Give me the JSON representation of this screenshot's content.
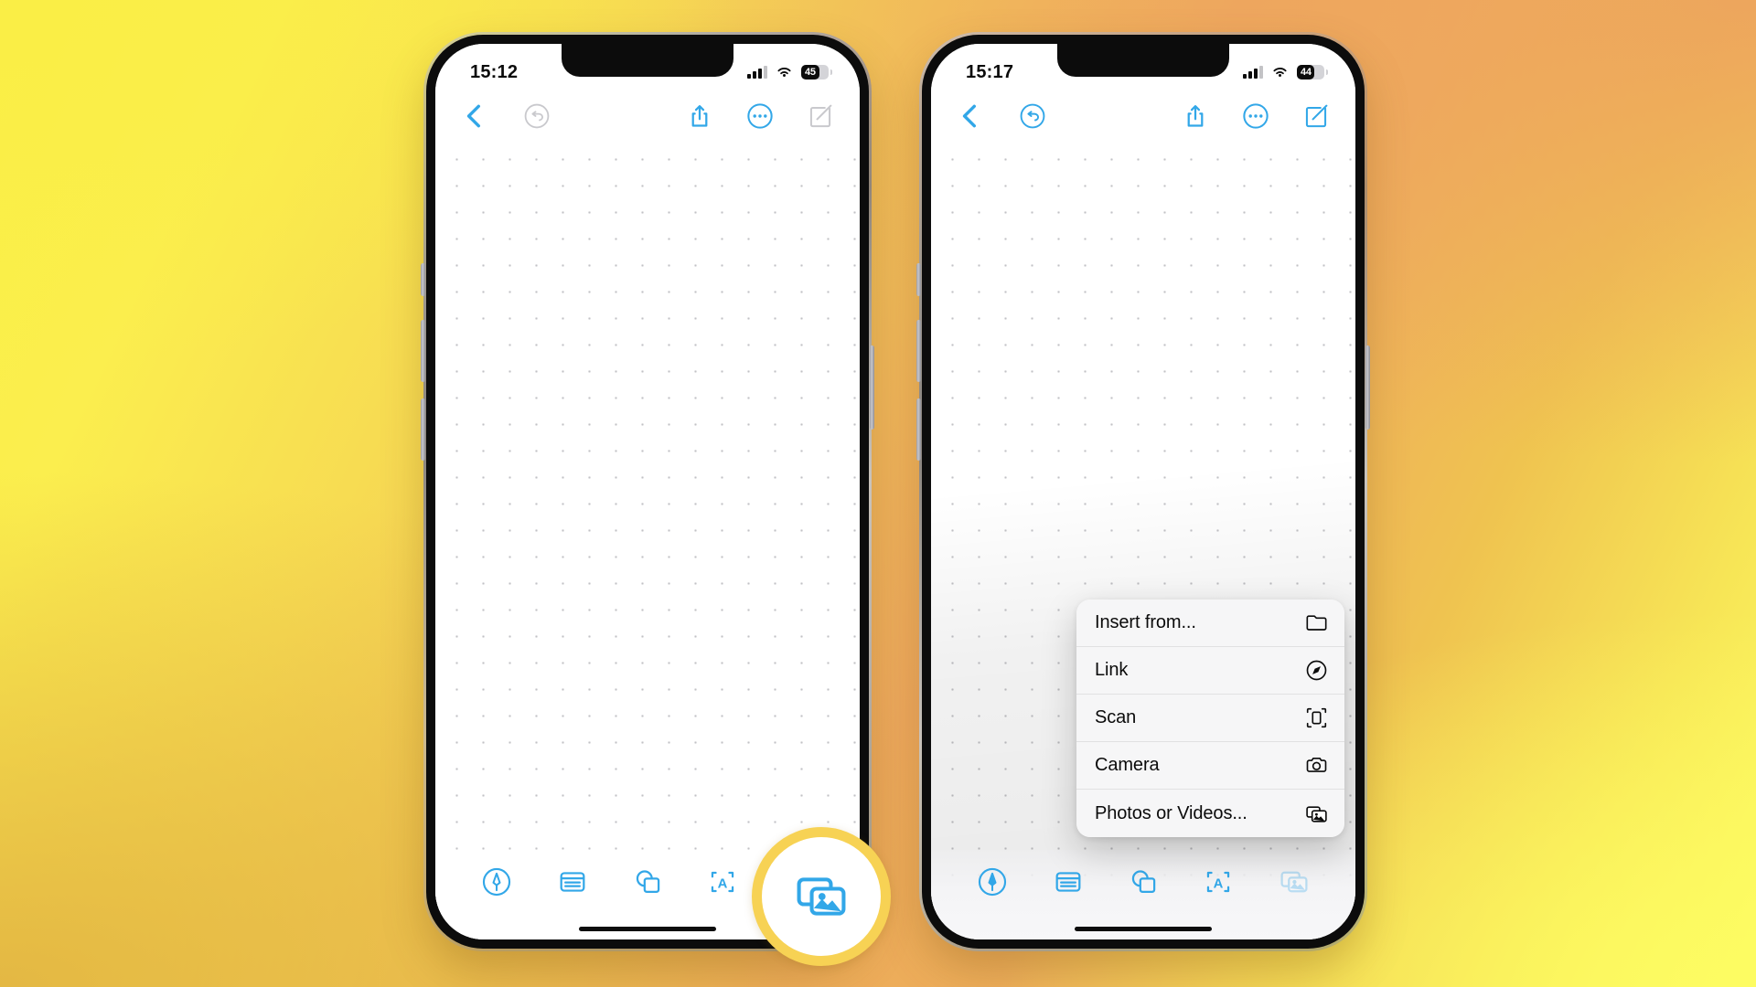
{
  "background": {
    "color_top_left": "#FAEC46",
    "color_top_right": "#EDA45E",
    "color_bottom_left": "#E5B845",
    "color_bottom_right": "#FDFC62"
  },
  "accent_color": "#32A7E8",
  "highlight_ring_color": "#F7D254",
  "phones": [
    {
      "id": "phone-left",
      "status_bar": {
        "time": "15:12",
        "signal_icon": "cellular-bars-icon",
        "wifi_icon": "wifi-icon",
        "battery_percent": "45"
      },
      "top_toolbar": {
        "left_items": [
          {
            "name": "back-button",
            "icon": "chevron-left-icon",
            "state": "active"
          },
          {
            "name": "undo-button",
            "icon": "undo-arrow-icon",
            "state": "disabled"
          }
        ],
        "right_items": [
          {
            "name": "share-button",
            "icon": "share-upload-icon",
            "state": "active"
          },
          {
            "name": "more-button",
            "icon": "ellipsis-circle-icon",
            "state": "active"
          },
          {
            "name": "compose-button",
            "icon": "compose-pencil-square-icon",
            "state": "disabled"
          }
        ]
      },
      "bottom_toolbar": {
        "items": [
          {
            "name": "draw-tool",
            "icon": "pen-circle-icon",
            "state": "active"
          },
          {
            "name": "note-tool",
            "icon": "note-lines-icon",
            "state": "active"
          },
          {
            "name": "shapes-tool",
            "icon": "shapes-icon",
            "state": "active"
          },
          {
            "name": "textbox-tool",
            "icon": "text-box-a-icon",
            "state": "active"
          },
          {
            "name": "media-tool",
            "icon": "photos-stack-icon",
            "state": "active"
          }
        ]
      },
      "context_menu": null
    },
    {
      "id": "phone-right",
      "status_bar": {
        "time": "15:17",
        "signal_icon": "cellular-bars-icon",
        "wifi_icon": "wifi-icon",
        "battery_percent": "44"
      },
      "top_toolbar": {
        "left_items": [
          {
            "name": "back-button",
            "icon": "chevron-left-icon",
            "state": "active"
          },
          {
            "name": "undo-button",
            "icon": "undo-arrow-icon",
            "state": "active"
          }
        ],
        "right_items": [
          {
            "name": "share-button",
            "icon": "share-upload-icon",
            "state": "active"
          },
          {
            "name": "more-button",
            "icon": "ellipsis-circle-icon",
            "state": "active"
          },
          {
            "name": "compose-button",
            "icon": "compose-pencil-square-icon",
            "state": "active"
          }
        ]
      },
      "bottom_toolbar": {
        "items": [
          {
            "name": "draw-tool",
            "icon": "pen-circle-icon",
            "state": "active"
          },
          {
            "name": "note-tool",
            "icon": "note-lines-icon",
            "state": "active"
          },
          {
            "name": "shapes-tool",
            "icon": "shapes-icon",
            "state": "active"
          },
          {
            "name": "textbox-tool",
            "icon": "text-box-a-icon",
            "state": "active"
          },
          {
            "name": "media-tool",
            "icon": "photos-stack-icon",
            "state": "selected-dimmed"
          }
        ]
      },
      "context_menu": {
        "items": [
          {
            "label": "Insert from...",
            "icon": "folder-icon"
          },
          {
            "label": "Link",
            "icon": "compass-link-icon"
          },
          {
            "label": "Scan",
            "icon": "document-scan-icon"
          },
          {
            "label": "Camera",
            "icon": "camera-icon"
          },
          {
            "label": "Photos or Videos...",
            "icon": "photos-stack-icon"
          }
        ]
      }
    }
  ],
  "callout": {
    "name": "media-tool-highlight",
    "icon": "photos-stack-icon",
    "ring_color": "#F7D254"
  }
}
